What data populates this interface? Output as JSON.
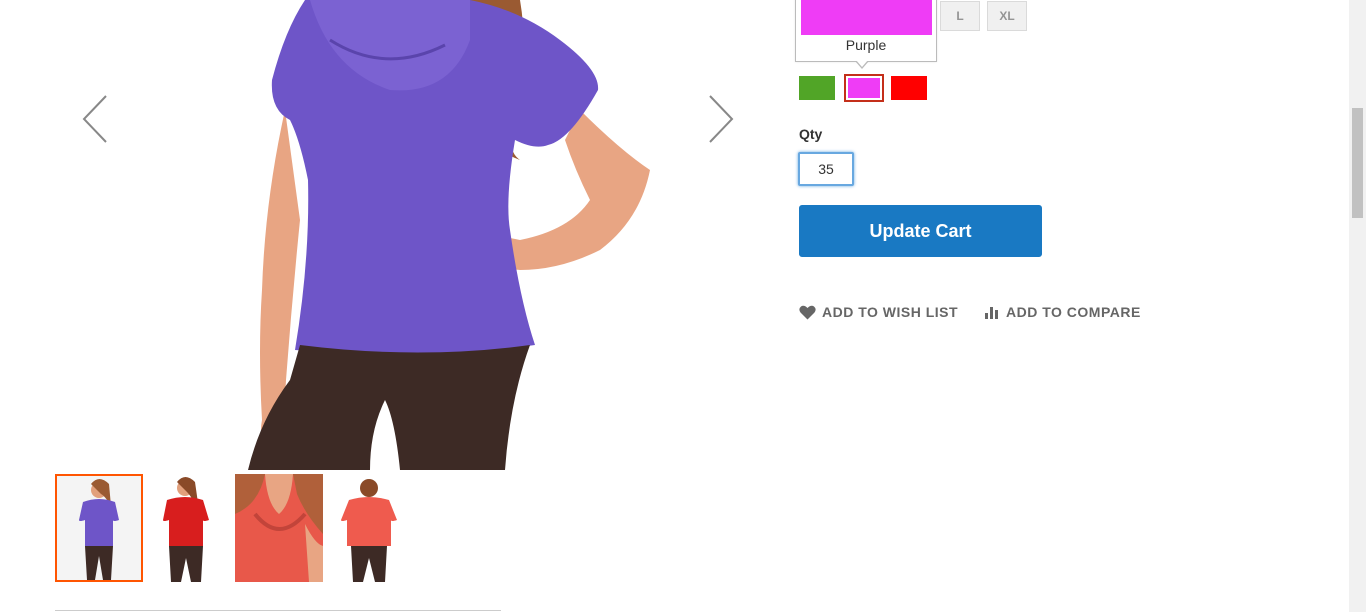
{
  "gallery": {
    "prev_label": "previous-arrow",
    "next_label": "next-arrow",
    "thumbnails": [
      {
        "name": "thumb-purple-front",
        "shirt_color": "#6e55c8",
        "active": true
      },
      {
        "name": "thumb-red-front",
        "shirt_color": "#d81e1e",
        "active": false
      },
      {
        "name": "thumb-coral-closeup",
        "shirt_color": "#e8584a",
        "active": false
      },
      {
        "name": "thumb-coral-back",
        "shirt_color": "#ef5b4e",
        "active": false
      }
    ]
  },
  "options": {
    "sizes": [
      "L",
      "XL"
    ],
    "tooltip": {
      "label": "Purple",
      "color": "#ef3cf6"
    },
    "colors": [
      {
        "name": "Green",
        "hex": "#51a527"
      },
      {
        "name": "Purple",
        "hex": "#ef3cf6",
        "selected": true
      },
      {
        "name": "Red",
        "hex": "#ff0000"
      }
    ]
  },
  "qty": {
    "label": "Qty",
    "value": "35"
  },
  "cart": {
    "update_label": "Update Cart"
  },
  "actions": {
    "wish_list": "Add to Wish List",
    "compare": "Add to Compare"
  },
  "colors": {
    "primary": "#1979c3",
    "thumb_active_border": "#ff5501",
    "selected_swatch_border": "#c42f1a"
  }
}
